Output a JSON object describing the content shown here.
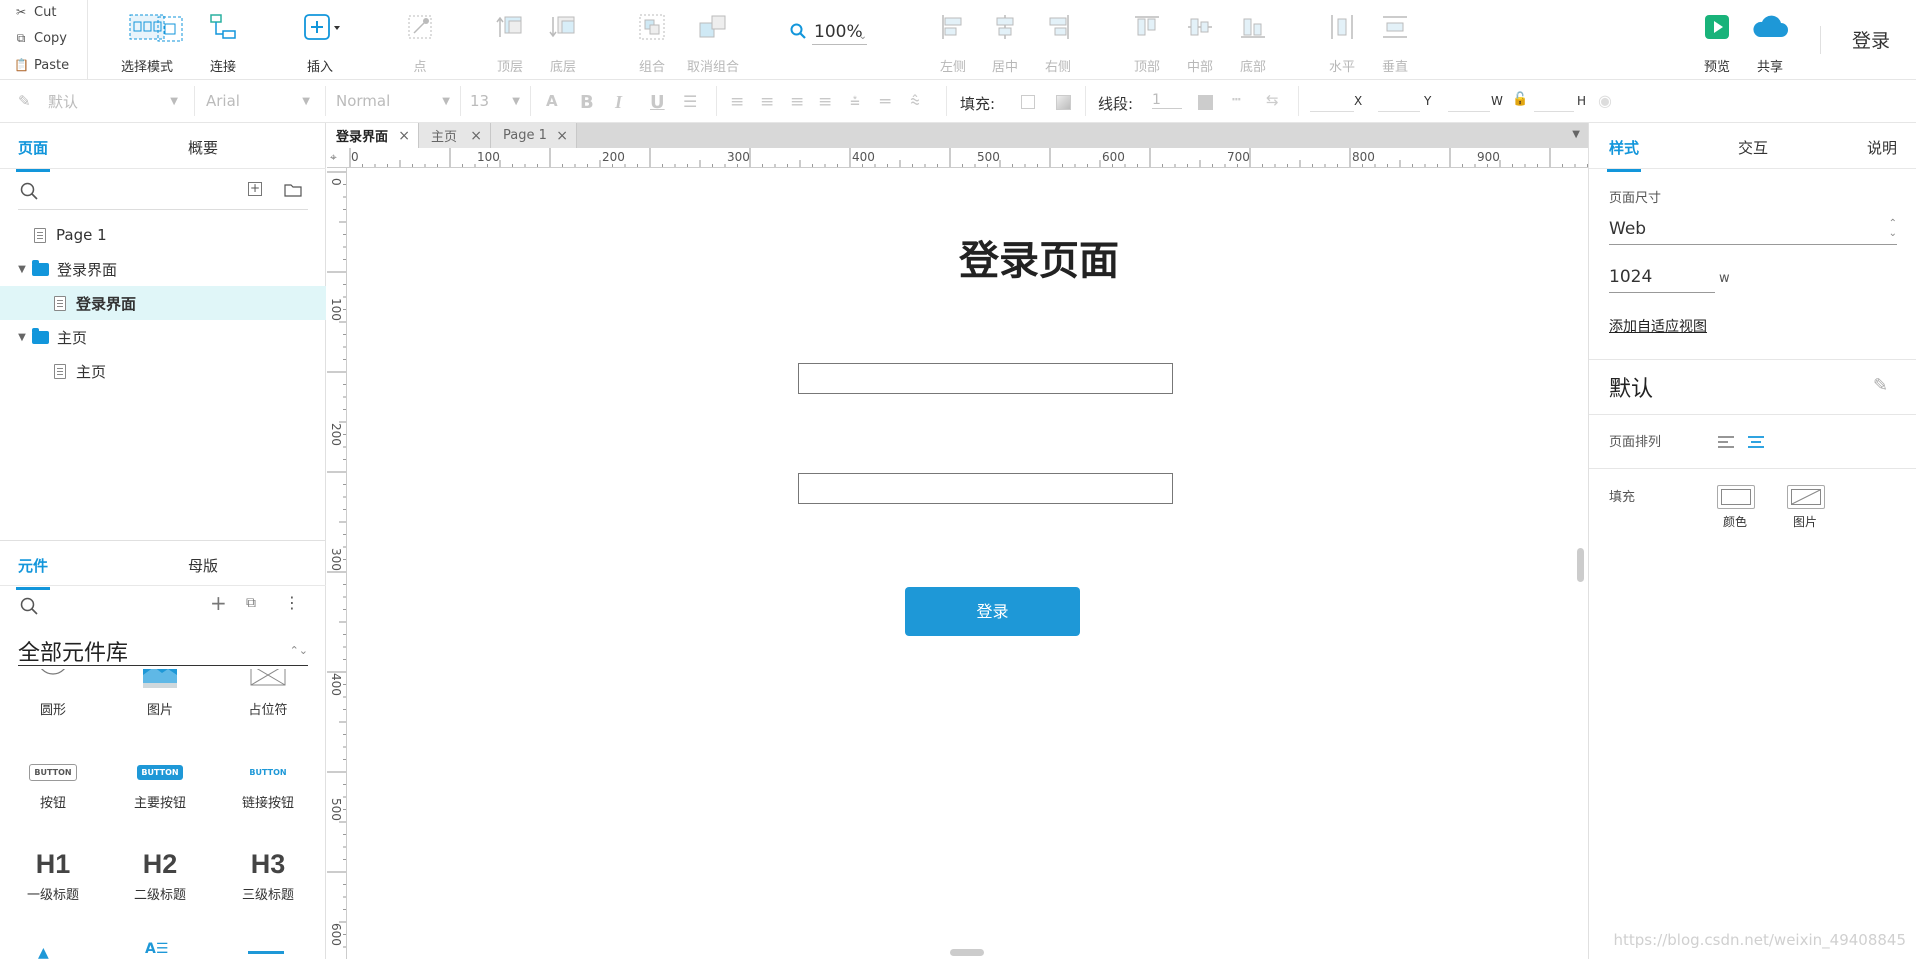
{
  "clipboard": {
    "cut": "Cut",
    "copy": "Copy",
    "paste": "Paste"
  },
  "toolbar": {
    "select_mode": "选择模式",
    "connect": "连接",
    "insert": "插入",
    "point": "点",
    "top_layer": "顶层",
    "bottom_layer": "底层",
    "group": "组合",
    "ungroup": "取消组合",
    "zoom": "100%",
    "align_left": "左侧",
    "align_center": "居中",
    "align_right": "右侧",
    "align_top": "顶部",
    "align_middle": "中部",
    "align_bottom": "底部",
    "distribute_h": "水平",
    "distribute_v": "垂直",
    "preview": "预览",
    "share": "共享",
    "login": "登录"
  },
  "format": {
    "style": "默认",
    "font": "Arial",
    "weight": "Normal",
    "size": "13",
    "fill_label": "填充:",
    "stroke_label": "线段:",
    "stroke_value": "1",
    "x": "X",
    "y": "Y",
    "w": "W",
    "h": "H"
  },
  "left": {
    "tab_pages": "页面",
    "tab_outline": "概要",
    "tree": [
      {
        "label": "Page 1"
      },
      {
        "label": "登录界面"
      },
      {
        "label": "登录界面"
      },
      {
        "label": "主页"
      },
      {
        "label": "主页"
      }
    ],
    "tab_widgets": "元件",
    "tab_masters": "母版",
    "library": "全部元件库",
    "widgets": [
      {
        "label": "圆形"
      },
      {
        "label": "图片"
      },
      {
        "label": "占位符"
      },
      {
        "label": "按钮",
        "preview": "BUTTON"
      },
      {
        "label": "主要按钮",
        "preview": "BUTTON"
      },
      {
        "label": "链接按钮",
        "preview": "BUTTON"
      },
      {
        "label": "一级标题",
        "preview": "H1"
      },
      {
        "label": "二级标题",
        "preview": "H2"
      },
      {
        "label": "三级标题",
        "preview": "H3"
      }
    ]
  },
  "doc_tabs": [
    {
      "label": "登录界面"
    },
    {
      "label": "主页"
    },
    {
      "label": "Page 1"
    }
  ],
  "ruler": {
    "h": [
      "0",
      "100",
      "200",
      "300",
      "400",
      "500",
      "600",
      "700",
      "800",
      "900"
    ],
    "v": [
      "0",
      "100",
      "200",
      "300",
      "400",
      "500",
      "600"
    ]
  },
  "canvas": {
    "title": "登录页面",
    "button": "登录"
  },
  "right": {
    "tab_style": "样式",
    "tab_interaction": "交互",
    "tab_notes": "说明",
    "page_size_label": "页面尺寸",
    "page_size_value": "Web",
    "width_value": "1024",
    "width_unit": "w",
    "adaptive_link": "添加自适应视图",
    "default_style": "默认",
    "page_align_label": "页面排列",
    "fill_label": "填充",
    "fill_color": "颜色",
    "fill_image": "图片"
  },
  "watermark": "https://blog.csdn.net/weixin_49408845",
  "colors": {
    "accent": "#1296db",
    "button": "#1e98d7",
    "selected_row": "#e0f6f8"
  }
}
